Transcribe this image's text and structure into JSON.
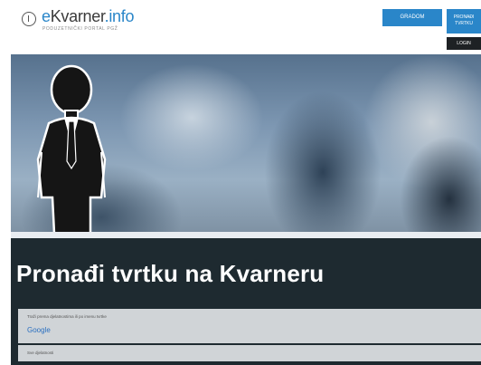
{
  "header": {
    "logo_e": "e",
    "logo_kvarner": "Kvarner",
    "logo_info": ".info",
    "logo_tagline": "PODUZETNIČKI PORTAL PGŽ",
    "btn_gradom": "GRADOM",
    "btn_pronadi_line1": "PRONAĐI",
    "btn_pronadi_line2": "TVRTKU",
    "btn_login": "LOGIN"
  },
  "hero": {
    "title": "Pronađi tvrtku na Kvarneru"
  },
  "search": {
    "label": "Traži prema djelatnostima ili po imenu tvrtke",
    "provider": "Google"
  },
  "filter": {
    "select_label": "Sve djelatnosti"
  },
  "colors": {
    "brand_blue": "#2a86c9",
    "dark_bg": "#1e2a30",
    "login_bg": "#1e2124"
  }
}
